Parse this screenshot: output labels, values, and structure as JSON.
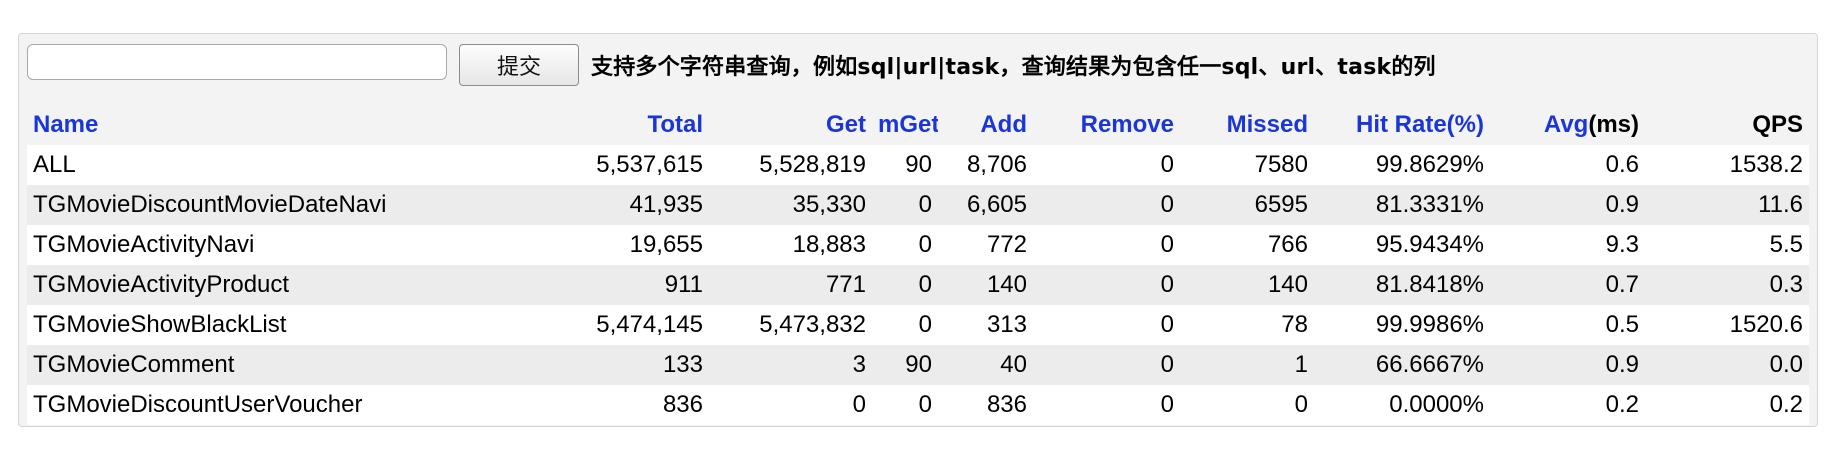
{
  "search": {
    "value": "",
    "placeholder": "",
    "submit_label": "提交",
    "hint": "支持多个字符串查询，例如sql|url|task，查询结果为包含任一sql、url、task的列"
  },
  "colors": {
    "link_header": "#1a35d8",
    "row_even": "#ececec",
    "row_odd": "#ffffff"
  },
  "table": {
    "headers": {
      "name": "Name",
      "total": "Total",
      "get": "Get",
      "mget": "mGet",
      "add": "Add",
      "remove": "Remove",
      "missed": "Missed",
      "hit_rate": "Hit Rate(%)",
      "avg_link": "Avg",
      "avg_unit": "(ms)",
      "qps": "QPS"
    },
    "rows": [
      {
        "name": "ALL",
        "total": "5,537,615",
        "get": "5,528,819",
        "mget": "90",
        "add": "8,706",
        "remove": "0",
        "missed": "7580",
        "hit_rate": "99.8629%",
        "avg": "0.6",
        "qps": "1538.2"
      },
      {
        "name": "TGMovieDiscountMovieDateNavi",
        "total": "41,935",
        "get": "35,330",
        "mget": "0",
        "add": "6,605",
        "remove": "0",
        "missed": "6595",
        "hit_rate": "81.3331%",
        "avg": "0.9",
        "qps": "11.6"
      },
      {
        "name": "TGMovieActivityNavi",
        "total": "19,655",
        "get": "18,883",
        "mget": "0",
        "add": "772",
        "remove": "0",
        "missed": "766",
        "hit_rate": "95.9434%",
        "avg": "9.3",
        "qps": "5.5"
      },
      {
        "name": "TGMovieActivityProduct",
        "total": "911",
        "get": "771",
        "mget": "0",
        "add": "140",
        "remove": "0",
        "missed": "140",
        "hit_rate": "81.8418%",
        "avg": "0.7",
        "qps": "0.3"
      },
      {
        "name": "TGMovieShowBlackList",
        "total": "5,474,145",
        "get": "5,473,832",
        "mget": "0",
        "add": "313",
        "remove": "0",
        "missed": "78",
        "hit_rate": "99.9986%",
        "avg": "0.5",
        "qps": "1520.6"
      },
      {
        "name": "TGMovieComment",
        "total": "133",
        "get": "3",
        "mget": "90",
        "add": "40",
        "remove": "0",
        "missed": "1",
        "hit_rate": "66.6667%",
        "avg": "0.9",
        "qps": "0.0"
      },
      {
        "name": "TGMovieDiscountUserVoucher",
        "total": "836",
        "get": "0",
        "mget": "0",
        "add": "836",
        "remove": "0",
        "missed": "0",
        "hit_rate": "0.0000%",
        "avg": "0.2",
        "qps": "0.2"
      }
    ]
  }
}
